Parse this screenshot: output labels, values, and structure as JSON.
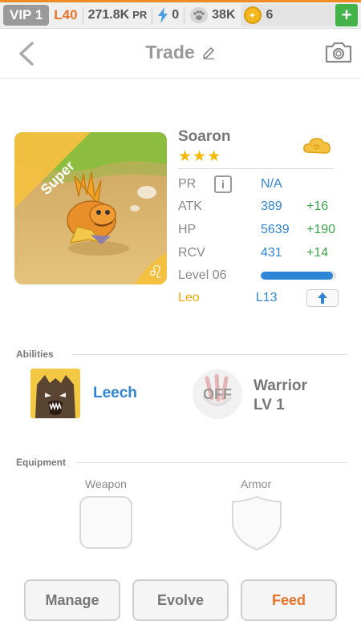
{
  "status": {
    "vip": "VIP 1",
    "level": "L40",
    "pr_value": "271.8K",
    "pr_unit": "PR",
    "energy": "0",
    "paw": "38K",
    "coins": "6"
  },
  "header": {
    "title": "Trade"
  },
  "creature": {
    "name": "Soaron",
    "rarity_label": "Super",
    "stars": "★★★",
    "stats": [
      {
        "key": "PR",
        "value": "N/A",
        "bonus": ""
      },
      {
        "key": "ATK",
        "value": "389",
        "bonus": "+16"
      },
      {
        "key": "HP",
        "value": "5639",
        "bonus": "+190"
      },
      {
        "key": "RCV",
        "value": "431",
        "bonus": "+14"
      }
    ],
    "level_label": "Level 06",
    "level_progress": 0.96,
    "sign_label": "Leo",
    "sign_level": "L13"
  },
  "abilities": {
    "section_label": "Abilities",
    "active": {
      "name": "Leech"
    },
    "passive": {
      "status": "OFF",
      "name": "Warrior",
      "level": "LV 1"
    }
  },
  "equipment": {
    "section_label": "Equipment",
    "weapon_label": "Weapon",
    "armor_label": "Armor"
  },
  "actions": {
    "manage": "Manage",
    "evolve": "Evolve",
    "feed": "Feed"
  },
  "colors": {
    "accent_orange": "#e8732a",
    "stat_blue": "#2f86d6",
    "bonus_green": "#3aa64a",
    "star_gold": "#f5b800"
  }
}
